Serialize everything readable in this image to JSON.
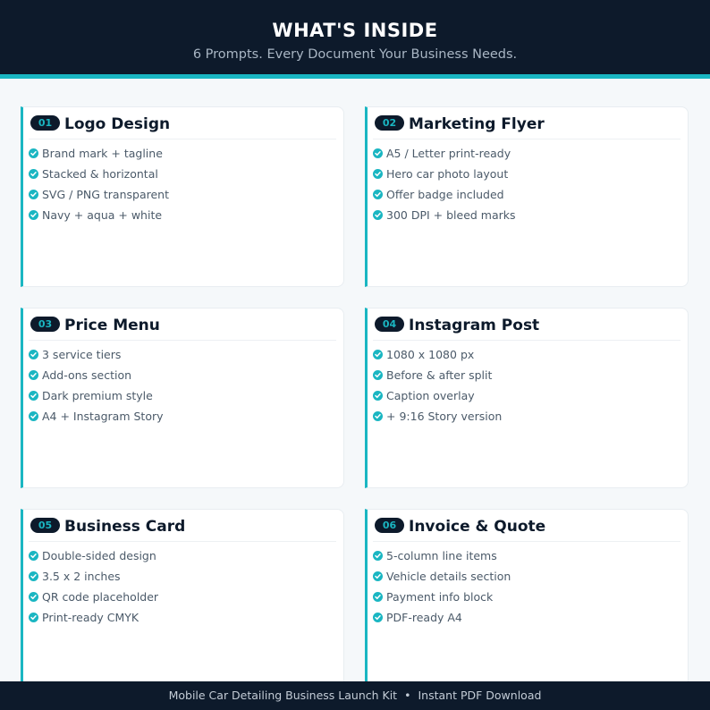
{
  "header": {
    "title": "WHAT'S INSIDE",
    "subtitle": "6 Prompts. Every Document Your Business Needs."
  },
  "colors": {
    "navy": "#0d1a2b",
    "accent": "#1ab6c2",
    "card_bg": "#ffffff",
    "page_bg": "#f5f8fa",
    "text_body": "#4b5a69"
  },
  "cards": [
    {
      "number": "01",
      "title": "Logo Design",
      "items": [
        "Brand mark + tagline",
        "Stacked & horizontal",
        "SVG / PNG transparent",
        "Navy + aqua + white"
      ]
    },
    {
      "number": "02",
      "title": "Marketing Flyer",
      "items": [
        "A5 / Letter print-ready",
        "Hero car photo layout",
        "Offer badge included",
        "300 DPI + bleed marks"
      ]
    },
    {
      "number": "03",
      "title": "Price Menu",
      "items": [
        "3 service tiers",
        "Add-ons section",
        "Dark premium style",
        "A4 + Instagram Story"
      ]
    },
    {
      "number": "04",
      "title": "Instagram Post",
      "items": [
        "1080 x 1080 px",
        "Before & after split",
        "Caption overlay",
        "+ 9:16 Story version"
      ]
    },
    {
      "number": "05",
      "title": "Business Card",
      "items": [
        "Double-sided design",
        "3.5 x 2 inches",
        "QR code placeholder",
        "Print-ready CMYK"
      ]
    },
    {
      "number": "06",
      "title": "Invoice & Quote",
      "items": [
        "5-column line items",
        "Vehicle details section",
        "Payment info block",
        "PDF-ready A4"
      ]
    }
  ],
  "icons": {
    "item_bullet": "check-circle-icon"
  },
  "footer": {
    "left_text": "Mobile Car Detailing Business Launch Kit",
    "separator": "•",
    "right_text": "Instant PDF Download"
  }
}
